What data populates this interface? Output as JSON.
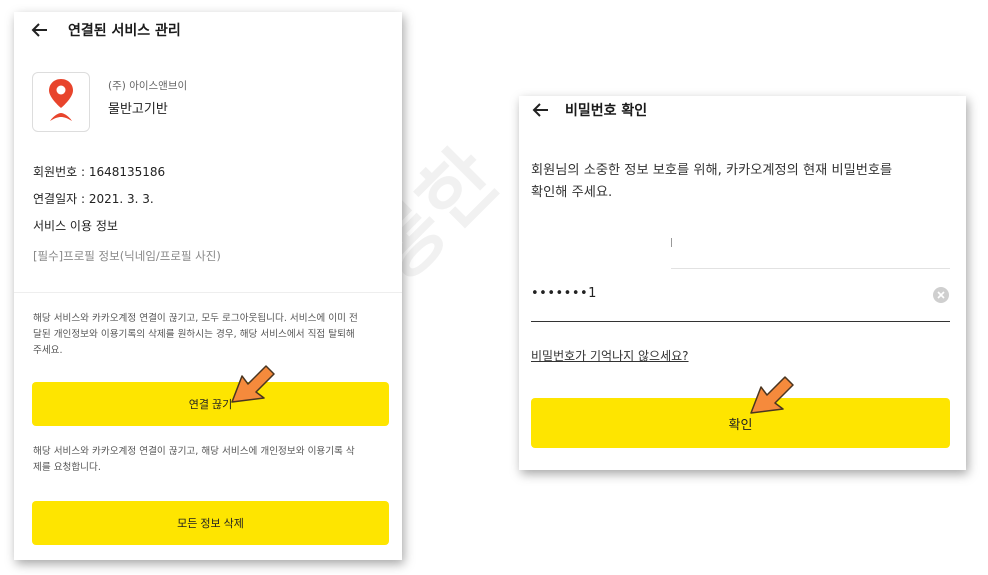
{
  "left_panel": {
    "header": {
      "title": "연결된 서비스 관리",
      "back_icon": "arrow-left-icon"
    },
    "app": {
      "company": "(주) 아이스앤브이",
      "name": "물반고기반",
      "icon": "map-pin-fish-icon"
    },
    "info": {
      "member_number": "회원번호 : 1648135186",
      "connected_date": "연결일자 : 2021. 3. 3.",
      "service_info_label": "서비스 이용 정보",
      "required_profile": "[필수]프로필 정보(닉네임/프로필 사진)"
    },
    "notices": {
      "disconnect_line1": "해당 서비스와 카카오계정 연결이 끊기고, 모두 로그아웃됩니다. 서비스에 이미 전",
      "disconnect_line2": "달된 개인정보와 이용기록의 삭제를 원하시는 경우, 해당 서비스에서 직접 탈퇴해",
      "disconnect_line3": "주세요.",
      "delete_line1": "해당 서비스와 카카오계정 연결이 끊기고, 해당 서비스에 개인정보와 이용기록 삭",
      "delete_line2": "제를 요청합니다."
    },
    "buttons": {
      "disconnect": "연결 끊기",
      "delete_all": "모든 정보 삭제"
    }
  },
  "right_panel": {
    "header": {
      "title": "비밀번호 확인",
      "back_icon": "arrow-left-icon"
    },
    "description_line1": "회원님의 소중한 정보 보호를 위해, 카카오계정의 현재 비밀번호를",
    "description_line2": "확인해 주세요.",
    "password_field": {
      "value": "•••••••1",
      "clear_icon": "clear-circle-icon"
    },
    "forgot_link": "비밀번호가 기억나지 않으세요?",
    "confirm_button": "확인"
  },
  "watermark": "설롱한",
  "colors": {
    "kakao_yellow": "#fee500",
    "arrow_orange": "#f58a3c",
    "pin_red": "#e8442c"
  },
  "annotations": {
    "arrow_icon": "pointer-arrow-icon"
  }
}
